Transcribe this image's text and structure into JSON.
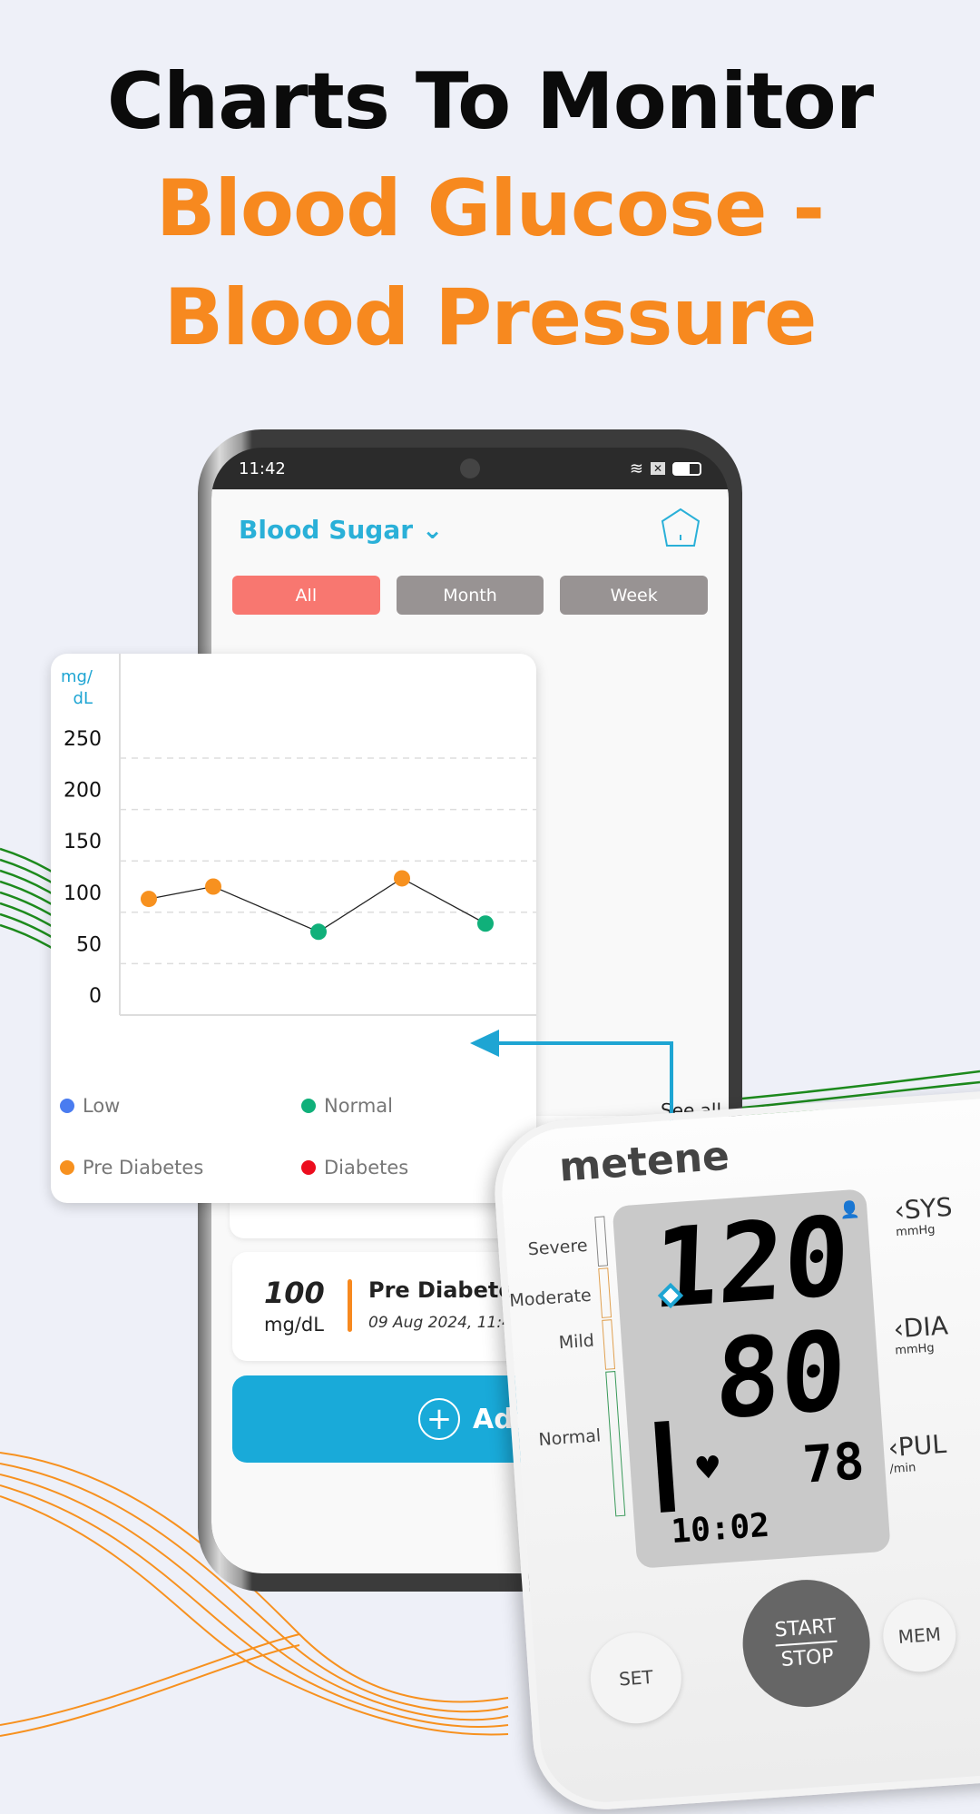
{
  "headline": {
    "line1": "Charts To Monitor",
    "line2": "Blood Glucose -",
    "line3": "Blood Pressure"
  },
  "phone": {
    "status_time": "11:42",
    "app_title": "Blood Sugar",
    "tabs": [
      {
        "label": "All",
        "active": true
      },
      {
        "label": "Month",
        "active": false
      },
      {
        "label": "Week",
        "active": false
      }
    ],
    "see_all": "See all",
    "reading": {
      "value": "100",
      "unit": "mg/dL",
      "status": "Pre Diabetes",
      "datetime": "09 Aug 2024, 11:4"
    },
    "add_button": "Add"
  },
  "chart_data": {
    "type": "line",
    "ylabel": "mg/dL",
    "yticks": [
      "0",
      "50",
      "100",
      "150",
      "200",
      "250"
    ],
    "ylim": [
      0,
      250
    ],
    "grid": true,
    "points": [
      {
        "y": 113,
        "category": "Pre Diabetes"
      },
      {
        "y": 125,
        "category": "Pre Diabetes"
      },
      {
        "y": 81,
        "category": "Normal"
      },
      {
        "y": 133,
        "category": "Pre Diabetes"
      },
      {
        "y": 89,
        "category": "Normal"
      }
    ],
    "legend": [
      {
        "name": "Low",
        "color": "#4a7cf0"
      },
      {
        "name": "Normal",
        "color": "#10b07a"
      },
      {
        "name": "Pre Diabetes",
        "color": "#f7911f"
      },
      {
        "name": "Diabetes",
        "color": "#ec0d1e"
      }
    ]
  },
  "monitor": {
    "brand": "metene",
    "scale": [
      "Severe",
      "Moderate",
      "Mild",
      "Normal"
    ],
    "sys": "120",
    "dia": "80",
    "pulse": "78",
    "time": "10:02",
    "labels": {
      "sys": "SYS",
      "sys_unit": "mmHg",
      "dia": "DIA",
      "dia_unit": "mmHg",
      "pul": "PUL",
      "pul_unit": "/min"
    },
    "buttons": {
      "set": "SET",
      "start": "START",
      "stop": "STOP",
      "mem": "MEM"
    }
  },
  "colors": {
    "accent": "#1ea5d3",
    "orange": "#f7891f"
  }
}
